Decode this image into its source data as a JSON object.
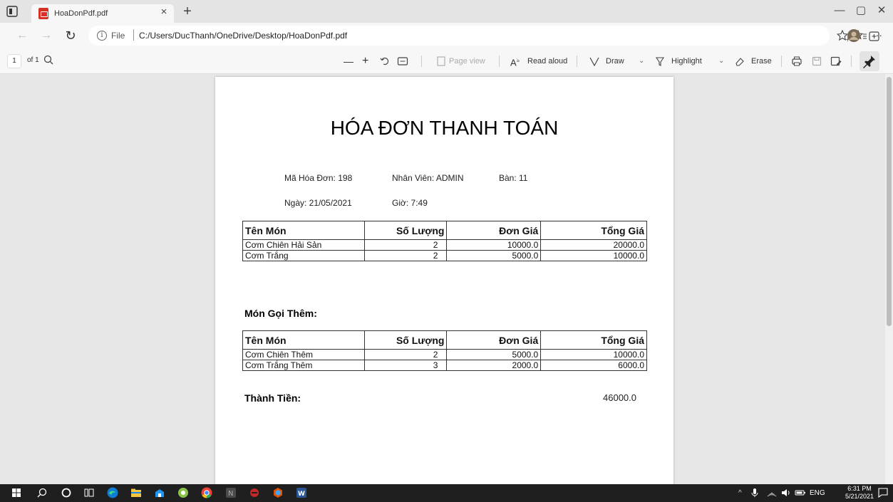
{
  "browser": {
    "tab_title": "HoaDonPdf.pdf",
    "tab_close": "×",
    "new_tab": "+",
    "window_minimize": "—",
    "window_maximize": "▢",
    "window_close": "✕",
    "address_scheme_label": "File",
    "address_url": "C:/Users/DucThanh/OneDrive/Desktop/HoaDonPdf.pdf"
  },
  "pdf_toolbar": {
    "page_number": "1",
    "page_count": "of 1",
    "zoom_out": "—",
    "zoom_in": "+",
    "page_view": "Page view",
    "read_aloud": "Read aloud",
    "draw": "Draw",
    "highlight": "Highlight",
    "erase": "Erase"
  },
  "invoice": {
    "title": "HÓA ĐƠN THANH TOÁN",
    "invoice_id": "Mã Hóa Đơn: 198",
    "staff": "Nhân Viên: ADMIN",
    "table_no": "Bàn: 11",
    "date": "Ngày: 21/05/2021",
    "time": "Giờ: 7:49",
    "headers": [
      "Tên Món",
      "Số Lượng",
      "Đơn Giá",
      "Tổng Giá"
    ],
    "items": [
      [
        "Cơm Chiên Hải Sản",
        "2",
        "10000.0",
        "20000.0"
      ],
      [
        "Cơm Trắng",
        "2",
        "5000.0",
        "10000.0"
      ]
    ],
    "extra_label": "Món Gọi Thêm:",
    "extra_items": [
      [
        "Cơm Chiên Thêm",
        "2",
        "5000.0",
        "10000.0"
      ],
      [
        "Cơm Trắng Thêm",
        "3",
        "2000.0",
        "6000.0"
      ]
    ],
    "total_label": "Thành Tiền:",
    "total_value": "46000.0"
  },
  "taskbar": {
    "language": "ENG",
    "time": "6:31 PM",
    "date": "5/21/2021"
  },
  "colors": {
    "pdf_red": "#d93025",
    "edge_blue": "#0f7bd4",
    "word_blue": "#2b5797"
  }
}
